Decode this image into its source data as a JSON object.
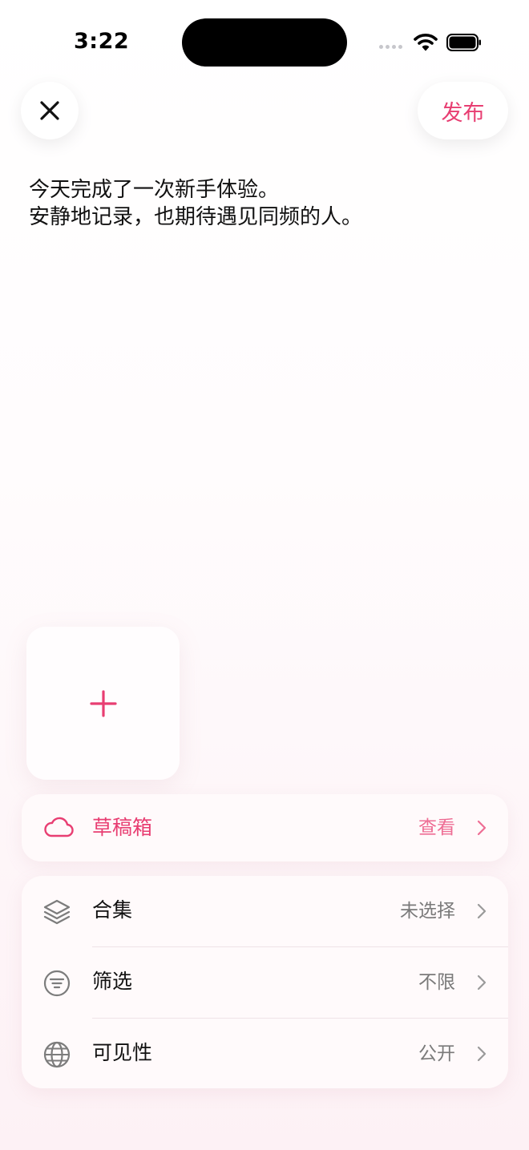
{
  "status_bar": {
    "time": "3:22"
  },
  "header": {
    "publish_label": "发布"
  },
  "post": {
    "lines": [
      "今天完成了一次新手体验。",
      "安静地记录，也期待遇见同频的人。"
    ]
  },
  "drafts": {
    "label": "草稿箱",
    "action": "查看",
    "icon": "cloud-icon"
  },
  "settings": [
    {
      "label": "合集",
      "value": "未选择",
      "icon": "layers-icon"
    },
    {
      "label": "筛选",
      "value": "不限",
      "icon": "filter-icon"
    },
    {
      "label": "可见性",
      "value": "公开",
      "icon": "globe-icon"
    }
  ],
  "colors": {
    "accent": "#e83e72",
    "accent_light": "#ee6d94",
    "muted_text": "#7a7a7a",
    "icon_gray": "#7c7c7c"
  }
}
